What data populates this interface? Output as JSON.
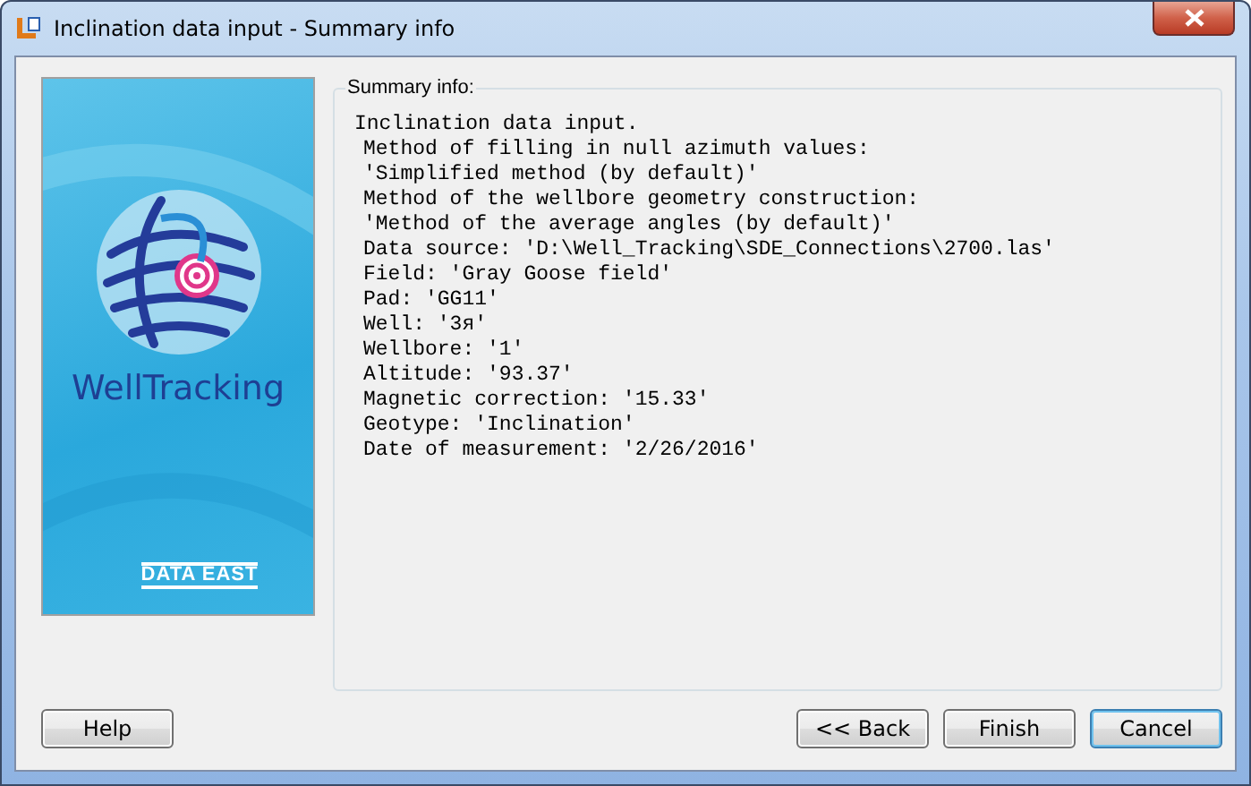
{
  "window": {
    "title": "Inclination data input - Summary info"
  },
  "banner": {
    "product": "WellTracking",
    "company": "DATA EAST"
  },
  "summary": {
    "legend": "Summary info:",
    "lines": [
      {
        "text": "Inclination data input.",
        "indented": false
      },
      {
        "text": "Method of filling in null azimuth values:",
        "indented": true
      },
      {
        "text": "'Simplified method (by default)'",
        "indented": true
      },
      {
        "text": "Method of the wellbore geometry construction:",
        "indented": true
      },
      {
        "text": "'Method of the average angles (by default)'",
        "indented": true
      },
      {
        "text": "Data source: 'D:\\Well_Tracking\\SDE_Connections\\2700.las'",
        "indented": true
      },
      {
        "text": "Field: 'Gray Goose field'",
        "indented": true
      },
      {
        "text": "Pad: 'GG11'",
        "indented": true
      },
      {
        "text": "Well: '3я'",
        "indented": true
      },
      {
        "text": "Wellbore: '1'",
        "indented": true
      },
      {
        "text": "Altitude: '93.37'",
        "indented": true
      },
      {
        "text": "Magnetic correction: '15.33'",
        "indented": true
      },
      {
        "text": "Geotype: 'Inclination'",
        "indented": true
      },
      {
        "text": "Date of measurement: '2/26/2016'",
        "indented": true
      }
    ]
  },
  "buttons": {
    "help": "Help",
    "right": [
      {
        "label": "<< Back",
        "default": false
      },
      {
        "label": "Finish",
        "default": false
      },
      {
        "label": "Cancel",
        "default": true
      }
    ]
  }
}
